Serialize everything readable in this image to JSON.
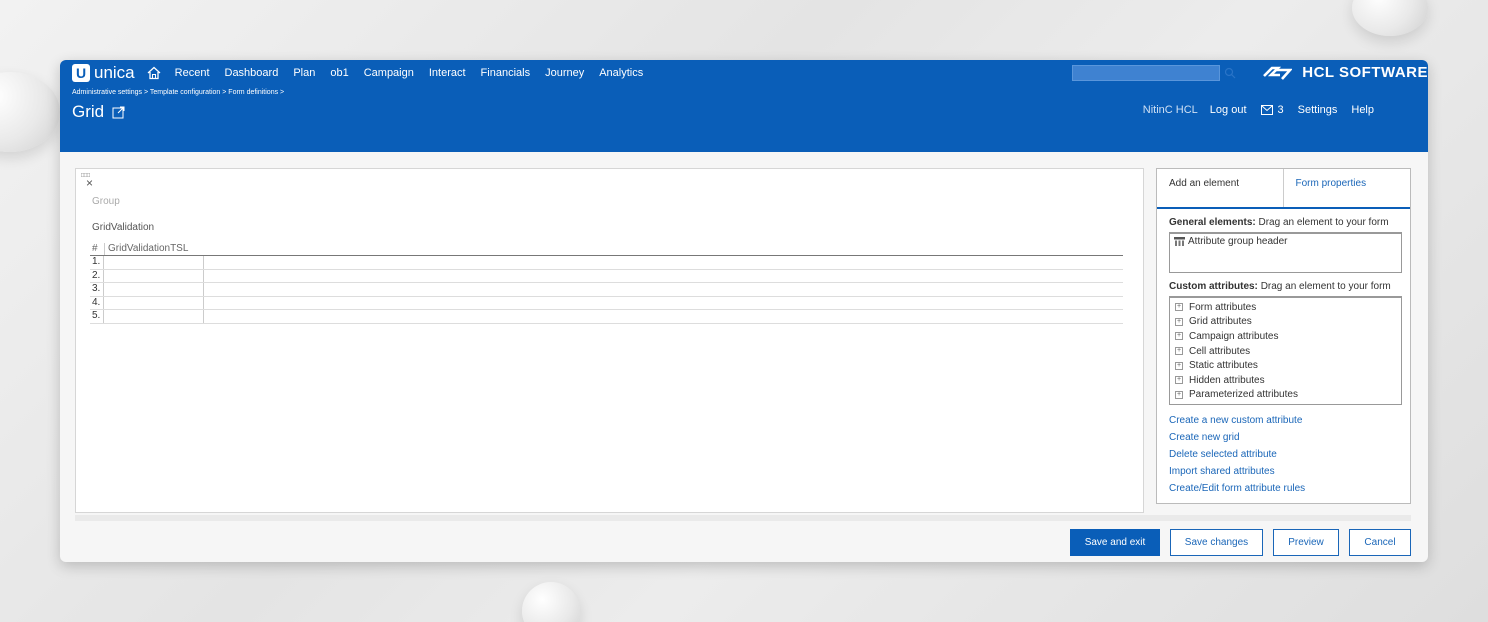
{
  "app": {
    "logo_text": "unica",
    "brand": "HCL SOFTWARE"
  },
  "nav": {
    "items": [
      "Recent",
      "Dashboard",
      "Plan",
      "ob1",
      "Campaign",
      "Interact",
      "Financials",
      "Journey",
      "Analytics"
    ]
  },
  "header": {
    "breadcrumb": "Administrative settings > Template configuration > Form definitions >",
    "title": "Grid",
    "username": "NitinC HCL",
    "logout": "Log out",
    "mail_count": "3",
    "settings": "Settings",
    "help": "Help"
  },
  "canvas": {
    "remove": "×",
    "group_label": "Group",
    "grid_name": "GridValidation",
    "columns": [
      "#",
      "GridValidationTSL"
    ],
    "rows": [
      "1.",
      "2.",
      "3.",
      "4.",
      "5."
    ]
  },
  "panel": {
    "tabs": [
      "Add an element",
      "Form properties"
    ],
    "general_title": "General elements:",
    "general_hint": "Drag an element to your form",
    "general_items": [
      "Attribute group header"
    ],
    "custom_title": "Custom attributes:",
    "custom_hint": "Drag an element to your form",
    "custom_items": [
      "Form attributes",
      "Grid attributes",
      "Campaign attributes",
      "Cell attributes",
      "Static attributes",
      "Hidden attributes",
      "Parameterized attributes"
    ],
    "actions": [
      "Create a new custom attribute",
      "Create new grid",
      "Delete selected attribute",
      "Import shared attributes",
      "Create/Edit form attribute rules"
    ]
  },
  "footer": {
    "save_exit": "Save and exit",
    "save_changes": "Save changes",
    "preview": "Preview",
    "cancel": "Cancel"
  },
  "colors": {
    "brand_blue": "#0a5eb8",
    "link_blue": "#1a66b8"
  }
}
